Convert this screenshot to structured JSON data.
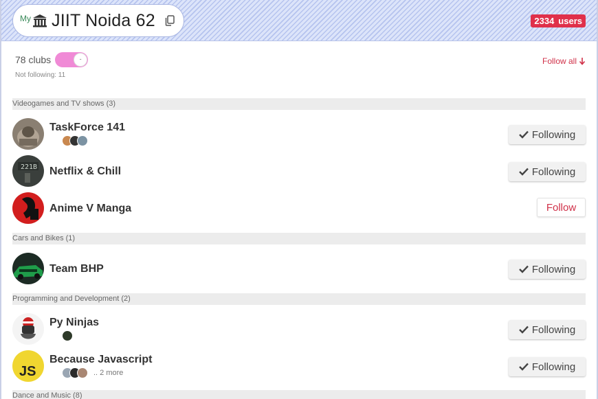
{
  "header": {
    "my_label": "My",
    "title": "JIIT Noida 62",
    "users_count": "2334",
    "users_label": "users"
  },
  "summary": {
    "clubs_count": "78 clubs",
    "not_following": "Not following: 11",
    "follow_all": "Follow all"
  },
  "sections": [
    {
      "title": "Videogames and TV shows (3)",
      "clubs": [
        {
          "name": "TaskForce 141",
          "button": "Following",
          "extra": ""
        },
        {
          "name": "Netflix & Chill",
          "button": "Following",
          "extra": ""
        },
        {
          "name": "Anime V Manga",
          "button": "Follow",
          "extra": ""
        }
      ]
    },
    {
      "title": "Cars and Bikes (1)",
      "clubs": [
        {
          "name": "Team BHP",
          "button": "Following",
          "extra": ""
        }
      ]
    },
    {
      "title": "Programming and Development (2)",
      "clubs": [
        {
          "name": "Py Ninjas",
          "button": "Following",
          "extra": ""
        },
        {
          "name": "Because Javascript",
          "button": "Following",
          "extra": ".. 2 more"
        }
      ]
    },
    {
      "title": "Dance and Music (8)",
      "clubs": []
    }
  ],
  "colors": {
    "accent": "#d03048",
    "badge": "#e0304a",
    "toggle": "#f08ad6"
  }
}
